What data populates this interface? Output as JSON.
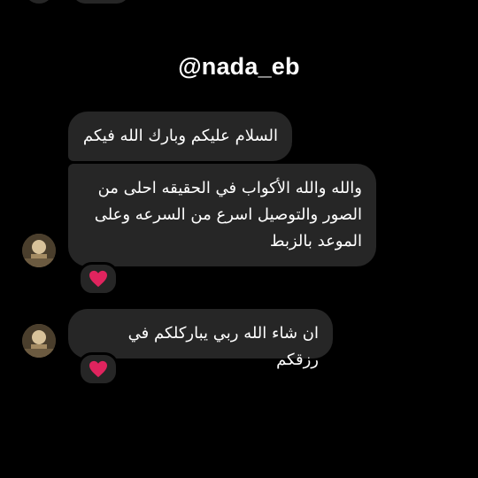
{
  "header": {
    "handle": "@nada_eb"
  },
  "messages": [
    {
      "text": "السلام عليكم وبارك الله فيكم"
    },
    {
      "text": "والله والله الأكواب  في الحقيقه احلى من الصور والتوصيل اسرع من السرعه وعلى الموعد بالزبط",
      "reaction": "heart"
    },
    {
      "text": "ان شاء الله ربي يباركلكم في رزقكم",
      "reaction": "heart"
    }
  ],
  "colors": {
    "background": "#000000",
    "bubble": "#262626",
    "text": "#ffffff",
    "heart": "#e0245e"
  },
  "icons": {
    "reaction": "red-heart-icon"
  }
}
